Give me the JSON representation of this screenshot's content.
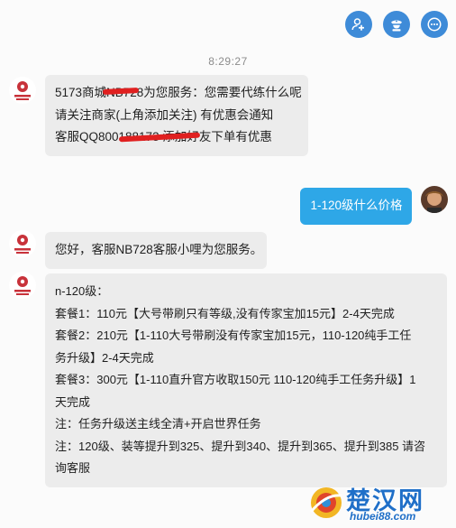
{
  "toolbar": {
    "add_friend_icon": "person-plus-icon",
    "service_icon": "customer-service-icon",
    "more_icon": "more-icon",
    "accent": "#3e8bd8"
  },
  "timestamp": "8:29:27",
  "messages": [
    {
      "side": "left",
      "lines": [
        "5173商城NB728为您服务：您需要代练什么呢",
        "请关注商家(上角添加关注) 有优惠会通知",
        "客服QQ800188173  添加好友下单有优惠"
      ]
    },
    {
      "side": "right",
      "lines": [
        "1-120级什么价格"
      ]
    },
    {
      "side": "left",
      "lines": [
        "您好，客服NB728客服小哩为您服务。"
      ]
    },
    {
      "side": "left",
      "lines": [
        "n-120级：",
        "套餐1：110元【大号带刷只有等级,没有传家宝加15元】2-4天完成",
        "套餐2：210元【1-110大号带刷没有传家宝加15元，110-120纯手工任",
        "务升级】2-4天完成",
        "套餐3：300元【1-110直升官方收取150元 110-120纯手工任务升级】1",
        "天完成",
        "注：任务升级送主线全清+开启世界任务",
        "注：120级、装等提升到325、提升到340、提升到365、提升到385 请咨",
        "询客服"
      ]
    }
  ],
  "colors": {
    "left_bubble": "#ececec",
    "right_bubble": "#2ea7e7",
    "scribble": "#e02020"
  },
  "watermark": {
    "title": "楚汉网",
    "url": "hubei88.com"
  }
}
